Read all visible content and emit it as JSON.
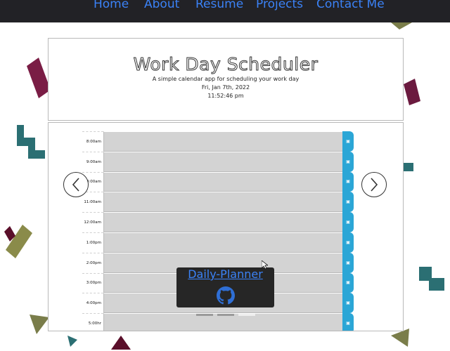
{
  "nav": {
    "items": [
      {
        "label": "Home"
      },
      {
        "label": "About"
      },
      {
        "label": "Resume"
      },
      {
        "label": "Projects"
      },
      {
        "label": "Contact Me"
      }
    ]
  },
  "header": {
    "title": "Work Day Scheduler",
    "subtitle": "A simple calendar app for scheduling your work day",
    "date": "Fri, Jan 7th, 2022",
    "time": "11:52:46 pm"
  },
  "schedule": {
    "hours": [
      "8:00am",
      "9:00am",
      "10:00am",
      "11:00am",
      "12:00am",
      "1:00pm",
      "2:00pm",
      "3:00pm",
      "4:00pm",
      "5:00hr"
    ],
    "save_icon": "save-icon"
  },
  "caption": {
    "title": "Daily-Planner",
    "icon": "github-icon"
  },
  "carousel": {
    "prev_icon": "chevron-left-icon",
    "next_icon": "chevron-right-icon",
    "slide_count": 3,
    "active_slide": 3
  },
  "colors": {
    "nav_bg": "#222226",
    "link": "#3b82f6",
    "save_button": "#2ba6d6",
    "row_bg": "#d3d3d3",
    "caption_bg": "#262626"
  }
}
